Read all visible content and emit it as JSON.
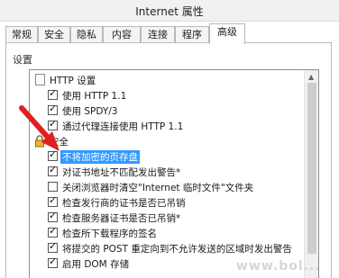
{
  "window": {
    "title": "Internet 属性"
  },
  "tabs": [
    {
      "label": "常规"
    },
    {
      "label": "安全"
    },
    {
      "label": "隐私"
    },
    {
      "label": "内容"
    },
    {
      "label": "连接"
    },
    {
      "label": "程序"
    },
    {
      "label": "高级",
      "active": true
    }
  ],
  "settings": {
    "section_label": "设置",
    "rows": [
      {
        "type": "group",
        "label": "HTTP 设置",
        "icon": "document-icon"
      },
      {
        "type": "checkbox",
        "label": "使用 HTTP 1.1",
        "checked": true
      },
      {
        "type": "checkbox",
        "label": "使用 SPDY/3",
        "checked": true
      },
      {
        "type": "checkbox",
        "label": "通过代理连接使用 HTTP 1.1",
        "checked": true
      },
      {
        "type": "group",
        "label": "安全",
        "icon": "lock-icon"
      },
      {
        "type": "checkbox",
        "label": "不将加密的页存盘",
        "checked": true,
        "selected": true
      },
      {
        "type": "checkbox",
        "label": "对证书地址不匹配发出警告*",
        "checked": true
      },
      {
        "type": "checkbox",
        "label": "关闭浏览器时清空\"Internet 临时文件\"文件夹",
        "checked": false
      },
      {
        "type": "checkbox",
        "label": "检查发行商的证书是否已吊销",
        "checked": true
      },
      {
        "type": "checkbox",
        "label": "检查服务器证书是否已吊销*",
        "checked": true
      },
      {
        "type": "checkbox",
        "label": "检查所下载程序的签名",
        "checked": true
      },
      {
        "type": "checkbox",
        "label": "将提交的 POST 重定向到不允许发送的区域时发出警告",
        "checked": true
      },
      {
        "type": "checkbox",
        "label": "启用 DOM 存储",
        "checked": true
      }
    ]
  },
  "colors": {
    "selection": "#3399ff",
    "annotation_arrow": "#e02020"
  },
  "watermark": "www.bol..."
}
